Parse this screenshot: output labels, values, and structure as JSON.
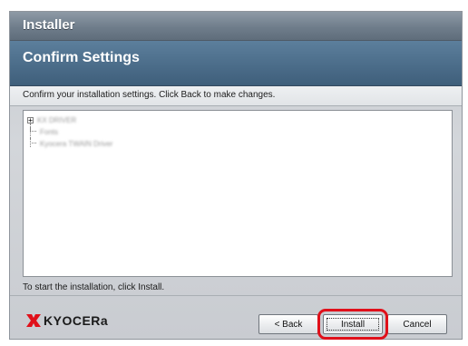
{
  "window": {
    "title": "Installer"
  },
  "header": {
    "heading": "Confirm Settings",
    "subtitle": "Confirm your installation settings. Click Back to make changes."
  },
  "tree": {
    "items": [
      {
        "label": "KX DRIVER",
        "expander": "+"
      },
      {
        "label": "Fonts"
      },
      {
        "label": "Kyocera TWAIN Driver"
      }
    ]
  },
  "footer": {
    "note": "To start the installation, click Install."
  },
  "logo": {
    "text": "KYOCERa",
    "color": "#e0101a"
  },
  "buttons": {
    "back": "< Back",
    "install": "Install",
    "cancel": "Cancel"
  },
  "colors": {
    "titlebar": "#6f7d8b",
    "header": "#4a6b88",
    "highlight": "#e0101a"
  }
}
